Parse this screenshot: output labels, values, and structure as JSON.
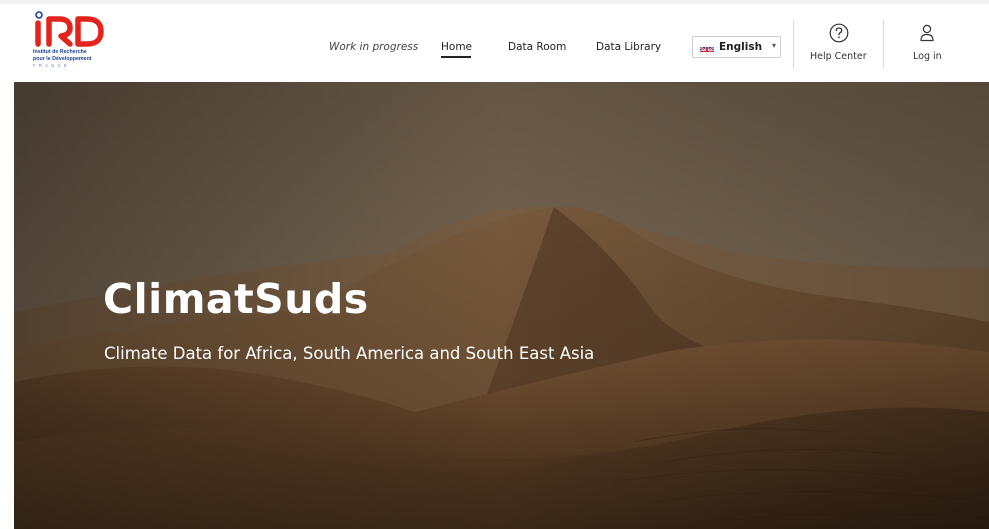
{
  "logo": {
    "mark": "IRD",
    "line1": "Institut de Recherche",
    "line2": "pour le Développement",
    "line3": "FRANCE",
    "colors": {
      "red": "#e2241d",
      "blue": "#1d3f93"
    }
  },
  "nav": {
    "work_in_progress": "Work in progress",
    "home": "Home",
    "data_room": "Data Room",
    "data_library": "Data Library"
  },
  "language": {
    "selected": "English",
    "flag_icon": "uk-flag-icon",
    "caret_icon": "caret-down-icon"
  },
  "help": {
    "label": "Help Center",
    "icon": "question-circle-icon"
  },
  "login": {
    "label": "Log in",
    "icon": "user-icon"
  },
  "hero": {
    "title": "ClimatSuds",
    "subtitle": "Climate Data for Africa, South America and South East Asia",
    "background": "desert-dunes-image"
  }
}
